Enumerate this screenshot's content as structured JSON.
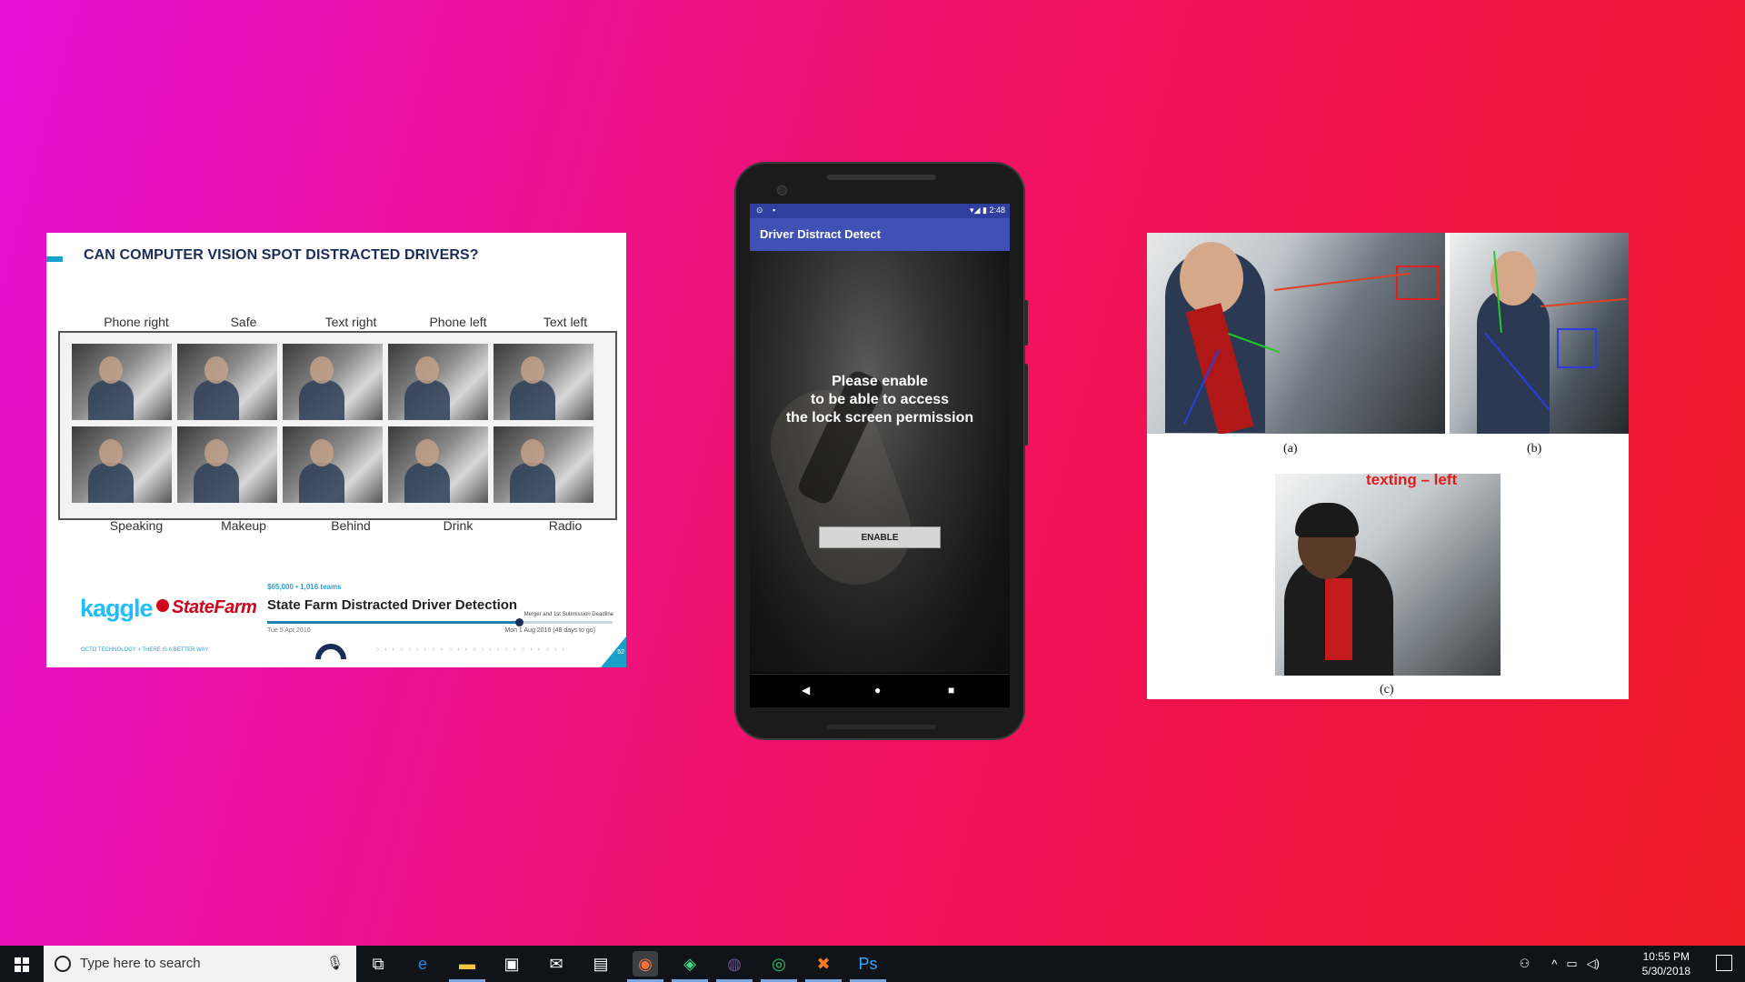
{
  "slide": {
    "title": "CAN COMPUTER VISION SPOT DISTRACTED DRIVERS?",
    "top_labels": [
      "Phone right",
      "Safe",
      "Text right",
      "Phone left",
      "Text left"
    ],
    "bottom_labels": [
      "Speaking",
      "Makeup",
      "Behind",
      "Drink",
      "Radio"
    ],
    "kaggle": "kaggle",
    "statefarm": "StateFarm",
    "prize": "$65,000 • 1,016 teams",
    "competition_title": "State Farm Distracted Driver Detection",
    "deadline_note": "Merger and 1st Submission Deadline",
    "start_date": "Tue 5 Apr 2016",
    "end_date": "Mon 1 Aug 2016 (48 days to go)",
    "timeline_progress": 0.73,
    "footer": "OCTO TECHNOLOGY > THERE IS A BETTER WAY",
    "page_number": "52",
    "accent_color": "#19a0c8"
  },
  "phone": {
    "status_time": "2:48",
    "status_left": "⊙ ▪",
    "status_right_icons": "▾◢ ▮",
    "app_title": "Driver Distract Detect",
    "message_line1": "Please enable",
    "message_line2": "to be able to access",
    "message_line3": "the lock screen permission",
    "button_label": "ENABLE",
    "nav_back": "◀",
    "nav_home": "●",
    "nav_recent": "■",
    "appbar_color": "#3f51b5"
  },
  "figure": {
    "caption_a": "(a)",
    "caption_b": "(b)",
    "caption_c": "(c)",
    "overlay_text": "texting – left"
  },
  "taskbar": {
    "search_placeholder": "Type here to search",
    "time": "10:55 PM",
    "date": "5/30/2018",
    "apps": [
      {
        "name": "task-view-icon",
        "glyph": "⧉"
      },
      {
        "name": "edge-icon",
        "glyph": "e"
      },
      {
        "name": "file-explorer-icon",
        "glyph": "▬"
      },
      {
        "name": "store-icon",
        "glyph": "▣"
      },
      {
        "name": "mail-icon",
        "glyph": "✉"
      },
      {
        "name": "photos-icon",
        "glyph": "▤"
      },
      {
        "name": "firefox-icon",
        "glyph": "◉"
      },
      {
        "name": "android-studio-icon",
        "glyph": "◈"
      },
      {
        "name": "github-icon",
        "glyph": "◍"
      },
      {
        "name": "sourcetree-icon",
        "glyph": "◎"
      },
      {
        "name": "xampp-icon",
        "glyph": "✖"
      },
      {
        "name": "photoshop-icon",
        "glyph": "Ps"
      }
    ]
  }
}
